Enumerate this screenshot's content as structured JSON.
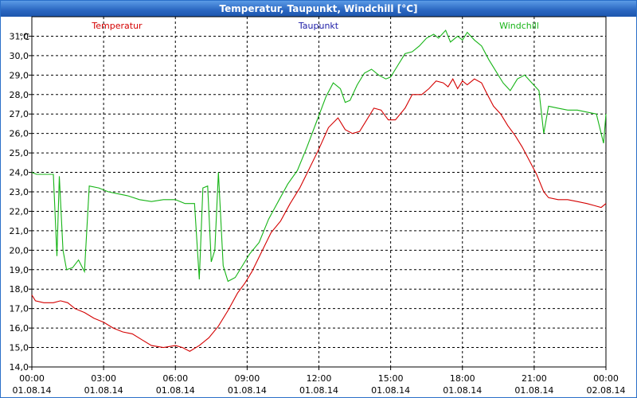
{
  "window": {
    "title": "Temperatur, Taupunkt, Windchill [°C]"
  },
  "chart_data": {
    "type": "line",
    "unit_label": "°C",
    "ylim": [
      14.0,
      32.0
    ],
    "yticks": [
      "14,0",
      "15,0",
      "16,0",
      "17,0",
      "18,0",
      "19,0",
      "20,0",
      "21,0",
      "22,0",
      "23,0",
      "24,0",
      "25,0",
      "26,0",
      "27,0",
      "28,0",
      "29,0",
      "30,0",
      "31,0"
    ],
    "xticks": [
      {
        "t": "00:00",
        "d": "01.08.14"
      },
      {
        "t": "03:00",
        "d": "01.08.14"
      },
      {
        "t": "06:00",
        "d": "01.08.14"
      },
      {
        "t": "09:00",
        "d": "01.08.14"
      },
      {
        "t": "12:00",
        "d": "01.08.14"
      },
      {
        "t": "15:00",
        "d": "01.08.14"
      },
      {
        "t": "18:00",
        "d": "01.08.14"
      },
      {
        "t": "21:00",
        "d": "01.08.14"
      },
      {
        "t": "00:00",
        "d": "02.08.14"
      }
    ],
    "grid": true,
    "series": [
      {
        "name": "Temperatur",
        "color": "#d40000",
        "points": [
          [
            0,
            17.7
          ],
          [
            0.15,
            17.4
          ],
          [
            0.5,
            17.3
          ],
          [
            0.9,
            17.3
          ],
          [
            1.2,
            17.4
          ],
          [
            1.5,
            17.3
          ],
          [
            1.8,
            17.0
          ],
          [
            2.2,
            16.8
          ],
          [
            2.6,
            16.5
          ],
          [
            3.0,
            16.3
          ],
          [
            3.4,
            16.0
          ],
          [
            3.8,
            15.8
          ],
          [
            4.2,
            15.7
          ],
          [
            4.6,
            15.4
          ],
          [
            5.0,
            15.1
          ],
          [
            5.5,
            15.0
          ],
          [
            6.0,
            15.1
          ],
          [
            6.3,
            15.0
          ],
          [
            6.6,
            14.8
          ],
          [
            7.0,
            15.1
          ],
          [
            7.4,
            15.5
          ],
          [
            7.8,
            16.1
          ],
          [
            8.2,
            16.9
          ],
          [
            8.6,
            17.8
          ],
          [
            8.9,
            18.3
          ],
          [
            9.2,
            18.9
          ],
          [
            9.6,
            19.9
          ],
          [
            10.0,
            20.9
          ],
          [
            10.4,
            21.5
          ],
          [
            10.8,
            22.4
          ],
          [
            11.2,
            23.2
          ],
          [
            11.6,
            24.2
          ],
          [
            12.0,
            25.2
          ],
          [
            12.4,
            26.3
          ],
          [
            12.8,
            26.8
          ],
          [
            13.1,
            26.2
          ],
          [
            13.4,
            26.0
          ],
          [
            13.7,
            26.1
          ],
          [
            14.0,
            26.7
          ],
          [
            14.3,
            27.3
          ],
          [
            14.6,
            27.2
          ],
          [
            14.9,
            26.7
          ],
          [
            15.2,
            26.7
          ],
          [
            15.6,
            27.3
          ],
          [
            15.9,
            28.0
          ],
          [
            16.3,
            28.0
          ],
          [
            16.6,
            28.3
          ],
          [
            16.9,
            28.7
          ],
          [
            17.2,
            28.6
          ],
          [
            17.4,
            28.4
          ],
          [
            17.6,
            28.8
          ],
          [
            17.8,
            28.3
          ],
          [
            18.0,
            28.7
          ],
          [
            18.2,
            28.5
          ],
          [
            18.5,
            28.8
          ],
          [
            18.8,
            28.6
          ],
          [
            19.0,
            28.1
          ],
          [
            19.3,
            27.4
          ],
          [
            19.6,
            27.0
          ],
          [
            19.9,
            26.4
          ],
          [
            20.2,
            25.9
          ],
          [
            20.5,
            25.3
          ],
          [
            20.8,
            24.6
          ],
          [
            21.1,
            23.9
          ],
          [
            21.4,
            23.0
          ],
          [
            21.6,
            22.7
          ],
          [
            22.0,
            22.6
          ],
          [
            22.4,
            22.6
          ],
          [
            22.8,
            22.5
          ],
          [
            23.2,
            22.4
          ],
          [
            23.5,
            22.3
          ],
          [
            23.8,
            22.2
          ],
          [
            24.0,
            22.4
          ]
        ]
      },
      {
        "name": "Taupunkt",
        "color": "#2020a8",
        "points": []
      },
      {
        "name": "Windchill",
        "color": "#16b416",
        "points": [
          [
            0,
            24.0
          ],
          [
            0.2,
            23.9
          ],
          [
            0.6,
            23.9
          ],
          [
            0.9,
            23.9
          ],
          [
            1.05,
            19.7
          ],
          [
            1.15,
            23.8
          ],
          [
            1.3,
            20.0
          ],
          [
            1.45,
            19.0
          ],
          [
            1.7,
            19.1
          ],
          [
            1.95,
            19.5
          ],
          [
            2.2,
            18.9
          ],
          [
            2.4,
            23.3
          ],
          [
            2.8,
            23.2
          ],
          [
            3.2,
            23.0
          ],
          [
            3.6,
            22.9
          ],
          [
            4.0,
            22.8
          ],
          [
            4.5,
            22.6
          ],
          [
            5.0,
            22.5
          ],
          [
            5.5,
            22.6
          ],
          [
            6.0,
            22.6
          ],
          [
            6.4,
            22.4
          ],
          [
            6.8,
            22.4
          ],
          [
            7.0,
            18.5
          ],
          [
            7.15,
            23.2
          ],
          [
            7.35,
            23.3
          ],
          [
            7.5,
            19.4
          ],
          [
            7.65,
            20.0
          ],
          [
            7.8,
            24.0
          ],
          [
            8.0,
            19.2
          ],
          [
            8.2,
            18.4
          ],
          [
            8.5,
            18.6
          ],
          [
            8.8,
            19.2
          ],
          [
            9.1,
            19.8
          ],
          [
            9.5,
            20.4
          ],
          [
            9.9,
            21.6
          ],
          [
            10.3,
            22.5
          ],
          [
            10.7,
            23.4
          ],
          [
            11.1,
            24.1
          ],
          [
            11.5,
            25.3
          ],
          [
            11.9,
            26.6
          ],
          [
            12.3,
            27.9
          ],
          [
            12.6,
            28.6
          ],
          [
            12.9,
            28.3
          ],
          [
            13.1,
            27.6
          ],
          [
            13.3,
            27.7
          ],
          [
            13.6,
            28.5
          ],
          [
            13.9,
            29.1
          ],
          [
            14.2,
            29.3
          ],
          [
            14.5,
            29.0
          ],
          [
            14.8,
            28.8
          ],
          [
            15.0,
            28.9
          ],
          [
            15.3,
            29.5
          ],
          [
            15.6,
            30.1
          ],
          [
            15.9,
            30.2
          ],
          [
            16.2,
            30.5
          ],
          [
            16.5,
            30.9
          ],
          [
            16.8,
            31.1
          ],
          [
            17.0,
            30.9
          ],
          [
            17.3,
            31.3
          ],
          [
            17.5,
            30.7
          ],
          [
            17.8,
            31.0
          ],
          [
            18.0,
            30.8
          ],
          [
            18.2,
            31.2
          ],
          [
            18.5,
            30.8
          ],
          [
            18.8,
            30.5
          ],
          [
            19.1,
            29.8
          ],
          [
            19.4,
            29.2
          ],
          [
            19.7,
            28.6
          ],
          [
            20.0,
            28.2
          ],
          [
            20.3,
            28.8
          ],
          [
            20.6,
            29.0
          ],
          [
            20.9,
            28.6
          ],
          [
            21.2,
            28.2
          ],
          [
            21.4,
            26.0
          ],
          [
            21.6,
            27.4
          ],
          [
            22.0,
            27.3
          ],
          [
            22.4,
            27.2
          ],
          [
            22.8,
            27.2
          ],
          [
            23.2,
            27.1
          ],
          [
            23.6,
            27.0
          ],
          [
            23.9,
            25.5
          ],
          [
            24.0,
            27.0
          ]
        ]
      }
    ]
  }
}
